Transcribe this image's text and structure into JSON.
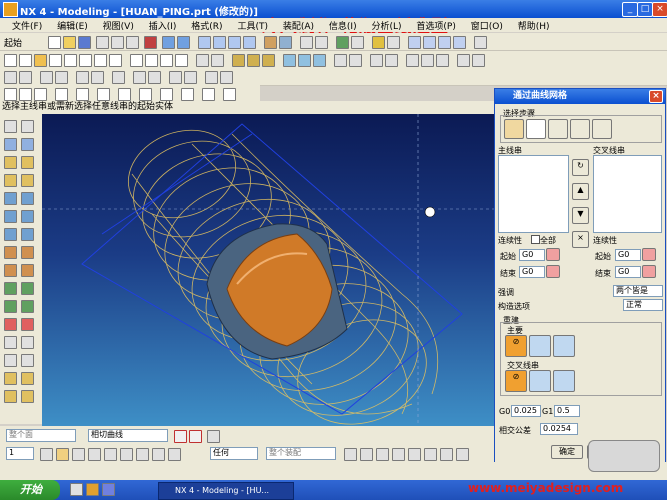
{
  "window": {
    "title": "NX 4 - Modeling - [HUAN_PING.prt (修改的)]",
    "overlay_caption": "冷风制作 花瓶图纸造型"
  },
  "menu": [
    "文件(F)",
    "编辑(E)",
    "视图(V)",
    "插入(I)",
    "格式(R)",
    "工具(T)",
    "装配(A)",
    "信息(I)",
    "分析(L)",
    "首选项(P)",
    "窗口(O)",
    "帮助(H)"
  ],
  "toolbar": {
    "start_label": "起始"
  },
  "status_prompt": "选择主线串或需新选择任意线串的起始实体",
  "dialog": {
    "title": "通过曲线网格",
    "selection_steps_label": "选择步骤",
    "primary_label": "主线串",
    "cross_label": "交叉线串",
    "continuity_label": "连续性",
    "all_label": "全部",
    "start_label": "起始",
    "end_label": "结束",
    "g0_value": "G0",
    "emphasis_label": "强调",
    "emphasis_value": "两个皆是",
    "construction_label": "构造选项",
    "construction_value": "正常",
    "rebuild_label": "重建",
    "primary_sub": "主要",
    "cross_sub": "交叉线串",
    "g0_tol_label": "G0",
    "g0_tol": "0.025",
    "g1_tol_label": "G1",
    "g1_tol": "0.5",
    "intersect_tol_label": "相交公差",
    "intersect_tol": "0.0254",
    "ok": "确定",
    "apply": "应用",
    "cancel": "取消"
  },
  "selection_bar": {
    "filter": "整个面",
    "curve_rule": "相切曲线",
    "scope": "任何",
    "assembly": "整个装配",
    "layer": "1"
  },
  "taskbar": {
    "start": "开始",
    "task": "NX 4 - Modeling - [HU..."
  },
  "watermark": "www.meiyadesign.com",
  "colors": {
    "viewport_top": "#0b1a54",
    "viewport_bottom": "#3e8fc6",
    "wire": "#e0c060",
    "surface": "#d07a28",
    "caption": "#e01010"
  }
}
